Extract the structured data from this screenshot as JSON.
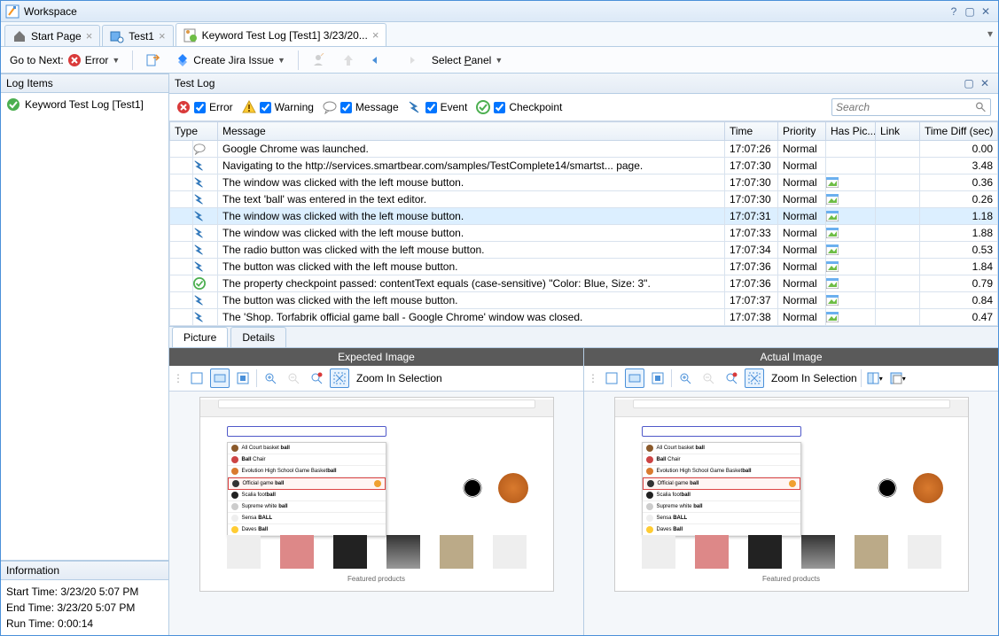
{
  "window": {
    "title": "Workspace"
  },
  "tabs": {
    "items": [
      {
        "label": "Start Page"
      },
      {
        "label": "Test1"
      },
      {
        "label": "Keyword Test Log [Test1] 3/23/20..."
      }
    ]
  },
  "toolbar": {
    "go_to_next": "Go to Next:",
    "error_label": "Error",
    "create_jira": "Create Jira Issue",
    "select_panel": "Select Panel"
  },
  "log_items": {
    "header": "Log Items",
    "root": "Keyword Test Log [Test1]"
  },
  "info": {
    "header": "Information",
    "start_time_label": "Start Time: ",
    "start_time": "3/23/20 5:07 PM",
    "end_time_label": "End Time: ",
    "end_time": "3/23/20 5:07 PM",
    "run_time_label": "Run Time: ",
    "run_time": "0:00:14"
  },
  "testlog": {
    "title": "Test Log"
  },
  "filters": {
    "error": "Error",
    "warning": "Warning",
    "message": "Message",
    "event": "Event",
    "checkpoint": "Checkpoint",
    "search_placeholder": "Search"
  },
  "grid": {
    "cols": {
      "type": "Type",
      "message": "Message",
      "time": "Time",
      "priority": "Priority",
      "haspic": "Has Pic...",
      "link": "Link",
      "timediff": "Time Diff (sec)"
    },
    "rows": [
      {
        "icon": "message",
        "msg": "Google Chrome was launched.",
        "time": "17:07:26",
        "prio": "Normal",
        "pic": false,
        "diff": "0.00",
        "sel": false
      },
      {
        "icon": "event",
        "msg": "Navigating to the http://services.smartbear.com/samples/TestComplete14/smartst... page.",
        "time": "17:07:30",
        "prio": "Normal",
        "pic": false,
        "diff": "3.48",
        "sel": false
      },
      {
        "icon": "event",
        "msg": "The window was clicked with the left mouse button.",
        "time": "17:07:30",
        "prio": "Normal",
        "pic": true,
        "diff": "0.36",
        "sel": false
      },
      {
        "icon": "event",
        "msg": "The text 'ball' was entered in the text editor.",
        "time": "17:07:30",
        "prio": "Normal",
        "pic": true,
        "diff": "0.26",
        "sel": false
      },
      {
        "icon": "event",
        "msg": "The window was clicked with the left mouse button.",
        "time": "17:07:31",
        "prio": "Normal",
        "pic": true,
        "diff": "1.18",
        "sel": true
      },
      {
        "icon": "event",
        "msg": "The window was clicked with the left mouse button.",
        "time": "17:07:33",
        "prio": "Normal",
        "pic": true,
        "diff": "1.88",
        "sel": false
      },
      {
        "icon": "event",
        "msg": "The radio button was clicked with the left mouse button.",
        "time": "17:07:34",
        "prio": "Normal",
        "pic": true,
        "diff": "0.53",
        "sel": false
      },
      {
        "icon": "event",
        "msg": "The button was clicked with the left mouse button.",
        "time": "17:07:36",
        "prio": "Normal",
        "pic": true,
        "diff": "1.84",
        "sel": false
      },
      {
        "icon": "checkpoint",
        "msg": "The property checkpoint passed: contentText equals (case-sensitive) \"Color: Blue, Size: 3\".",
        "time": "17:07:36",
        "prio": "Normal",
        "pic": true,
        "diff": "0.79",
        "sel": false
      },
      {
        "icon": "event",
        "msg": "The button was clicked with the left mouse button.",
        "time": "17:07:37",
        "prio": "Normal",
        "pic": true,
        "diff": "0.84",
        "sel": false
      },
      {
        "icon": "event",
        "msg": "The 'Shop. Torfabrik official game ball - Google Chrome' window was closed.",
        "time": "17:07:38",
        "prio": "Normal",
        "pic": true,
        "diff": "0.47",
        "sel": false
      }
    ]
  },
  "picture": {
    "tab_picture": "Picture",
    "tab_details": "Details",
    "expected": "Expected Image",
    "actual": "Actual Image",
    "zoom": "Zoom In Selection"
  }
}
